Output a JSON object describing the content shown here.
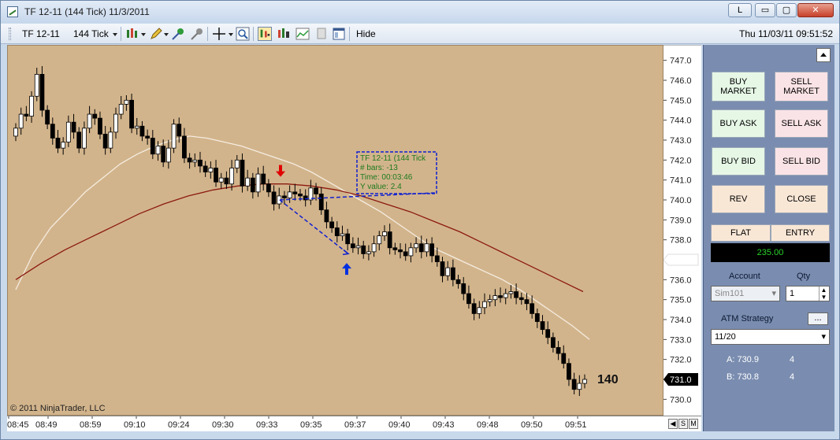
{
  "window": {
    "title": "TF 12-11 (144 Tick)  11/3/2011",
    "btn_l": "L",
    "btn_min": "▭",
    "btn_max": "▢",
    "btn_close": "✕"
  },
  "toolbar": {
    "instrument": "TF 12-11",
    "interval": "144 Tick",
    "hide_label": "Hide",
    "datetime": "Thu 11/03/11 09:51:52"
  },
  "chart": {
    "copyright": "© 2011 NinjaTrader, LLC",
    "last_price_tag": "731.0",
    "scale_tag": "",
    "countdown": "140",
    "mini_buttons": [
      "S",
      "M"
    ],
    "tooltip": {
      "lines": [
        "TF 12-11 (144 Tick",
        "# bars:   -13",
        "Time:     00:03:46",
        "Y value: 2.4"
      ]
    }
  },
  "chart_data": {
    "type": "candlestick",
    "ylim": [
      729.5,
      747.5
    ],
    "y_ticks": [
      "747.0",
      "746.0",
      "745.0",
      "744.0",
      "743.0",
      "742.0",
      "741.0",
      "740.0",
      "739.0",
      "738.0",
      "737.0",
      "736.0",
      "735.0",
      "734.0",
      "733.0",
      "732.0",
      "731.0",
      "730.0"
    ],
    "x_ticks": [
      "08:45",
      "08:49",
      "08:59",
      "09:10",
      "09:24",
      "09:30",
      "09:33",
      "09:35",
      "09:37",
      "09:40",
      "09:43",
      "09:48",
      "09:50",
      "09:51"
    ],
    "closes": [
      743.6,
      744.3,
      744.2,
      745.2,
      746.3,
      744.5,
      743.8,
      743.1,
      742.6,
      742.9,
      743.9,
      743.4,
      742.6,
      743.6,
      744.3,
      744.1,
      743.3,
      742.6,
      743.4,
      744.3,
      744.8,
      745.0,
      743.6,
      743.7,
      743.2,
      743.1,
      742.3,
      742.7,
      741.9,
      742.6,
      743.8,
      743.2,
      742.1,
      741.9,
      742.0,
      741.7,
      741.4,
      741.6,
      740.9,
      741.1,
      740.8,
      741.6,
      742.0,
      740.7,
      741.1,
      740.4,
      741.3,
      740.8,
      740.4,
      739.8,
      740.2,
      740.1,
      740.4,
      740.3,
      740.2,
      740.0,
      740.6,
      740.3,
      739.5,
      738.9,
      738.6,
      738.2,
      738.3,
      737.8,
      737.6,
      737.7,
      737.3,
      737.4,
      737.8,
      738.2,
      738.4,
      737.6,
      737.5,
      737.4,
      737.2,
      737.6,
      737.8,
      737.4,
      737.8,
      737.2,
      736.9,
      736.2,
      736.6,
      736.0,
      735.8,
      735.3,
      734.8,
      734.3,
      734.6,
      734.9,
      735.0,
      735.2,
      735.1,
      735.3,
      735.4,
      735.1,
      735.0,
      734.8,
      734.3,
      733.9,
      733.5,
      733.1,
      732.6,
      732.3,
      731.8,
      731.0,
      730.5,
      730.8,
      731.0
    ],
    "series": [
      {
        "name": "",
        "values": [
          735.5,
          737.3,
          738.6,
          739.5,
          740.4,
          741.1,
          741.8,
          742.3,
          742.7,
          743.0,
          743.2,
          743.1,
          742.9,
          742.7,
          742.4,
          742.1,
          741.8,
          741.4,
          740.9,
          740.4,
          739.9,
          739.4,
          738.8,
          738.2,
          737.6,
          737.2,
          736.8,
          736.4,
          736.0,
          735.5,
          734.9,
          734.3,
          733.7,
          733.0
        ]
      },
      {
        "name": "",
        "values": [
          736.0,
          736.8,
          737.5,
          738.1,
          738.7,
          739.3,
          739.8,
          740.2,
          740.5,
          740.7,
          740.8,
          740.8,
          740.7,
          740.5,
          740.2,
          739.8,
          739.4,
          738.9,
          738.4,
          737.8,
          737.2,
          736.6,
          736.0,
          735.4
        ]
      }
    ],
    "arrows": [
      {
        "type": "down",
        "color": "#e00000",
        "price": 741.2
      },
      {
        "type": "up",
        "color": "#0030e0",
        "price": 736.8
      }
    ]
  },
  "panel": {
    "buttons": [
      {
        "label": "BUY\nMARKET",
        "kind": "buy"
      },
      {
        "label": "SELL\nMARKET",
        "kind": "sell"
      },
      {
        "label": "BUY ASK",
        "kind": "buy"
      },
      {
        "label": "SELL ASK",
        "kind": "sell"
      },
      {
        "label": "BUY BID",
        "kind": "buy"
      },
      {
        "label": "SELL BID",
        "kind": "sell"
      },
      {
        "label": "REV",
        "kind": "neutral"
      },
      {
        "label": "CLOSE",
        "kind": "neutral"
      }
    ],
    "position": "FLAT",
    "entry": "ENTRY",
    "pnl": "235.00",
    "account_label": "Account",
    "qty_label": "Qty",
    "account_value": "Sim101",
    "qty_value": "1",
    "atm_label": "ATM Strategy",
    "atm_value": "11/20",
    "atm_btn": "...",
    "ask_label": "A: 730.9",
    "ask_qty": "4",
    "bid_label": "B: 730.8",
    "bid_qty": "4"
  },
  "colors": {
    "chart_bg": "#d2b48c",
    "ma_fast": "#f5ece0",
    "ma_slow": "#8b1a10",
    "pnl_text": "#29d329",
    "panel_bg": "#7a8db0"
  }
}
